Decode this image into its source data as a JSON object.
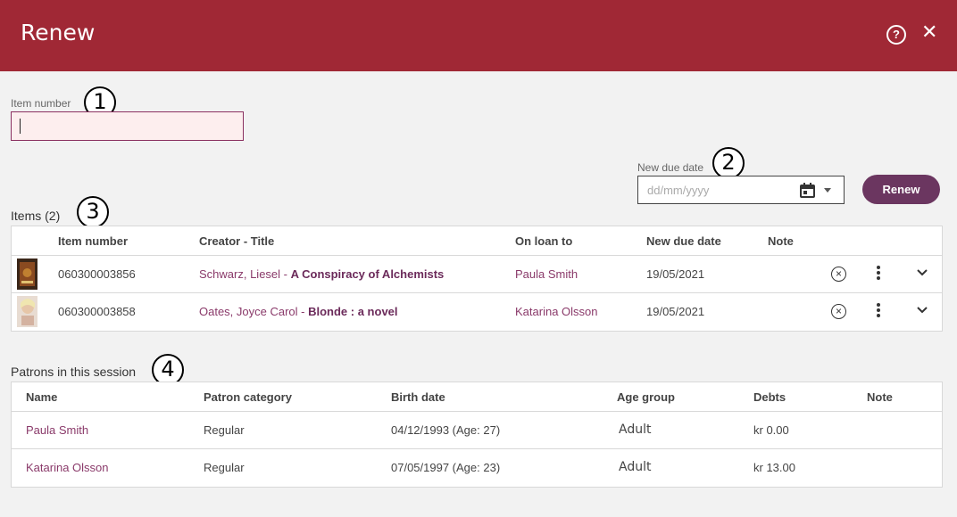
{
  "header": {
    "title": "Renew",
    "help_label": "?",
    "close_label": "✕"
  },
  "callouts": {
    "c1": "1",
    "c2": "2",
    "c3": "3",
    "c4": "4"
  },
  "item_field": {
    "label": "Item number",
    "value": ""
  },
  "due_field": {
    "label": "New due date",
    "placeholder": "dd/mm/yyyy"
  },
  "renew_button": "Renew",
  "items": {
    "title": "Items (2)",
    "columns": [
      "Item number",
      "Creator - Title",
      "On loan to",
      "New due date",
      "Note"
    ],
    "rows": [
      {
        "item_number": "060300003856",
        "creator": "Schwarz, Liesel - ",
        "title": "A Conspiracy of Alchemists",
        "on_loan_to": "Paula Smith",
        "new_due_date": "19/05/2021"
      },
      {
        "item_number": "060300003858",
        "creator": "Oates, Joyce Carol - ",
        "title": "Blonde : a novel",
        "on_loan_to": "Katarina Olsson",
        "new_due_date": "19/05/2021"
      }
    ]
  },
  "patrons": {
    "title": "Patrons in this session",
    "columns": [
      "Name",
      "Patron category",
      "Birth date",
      "Age group",
      "Debts",
      "Note"
    ],
    "rows": [
      {
        "name": "Paula Smith",
        "category": "Regular",
        "birth_date": "04/12/1993 (Age: 27)",
        "age_group": "Adult",
        "debts": "kr 0.00"
      },
      {
        "name": "Katarina Olsson",
        "category": "Regular",
        "birth_date": "07/05/1997 (Age: 23)",
        "age_group": "Adult",
        "debts": "kr 13.00"
      }
    ]
  },
  "colors": {
    "header": "#a02835",
    "accent": "#6b3660",
    "link": "#8a3a6a"
  }
}
